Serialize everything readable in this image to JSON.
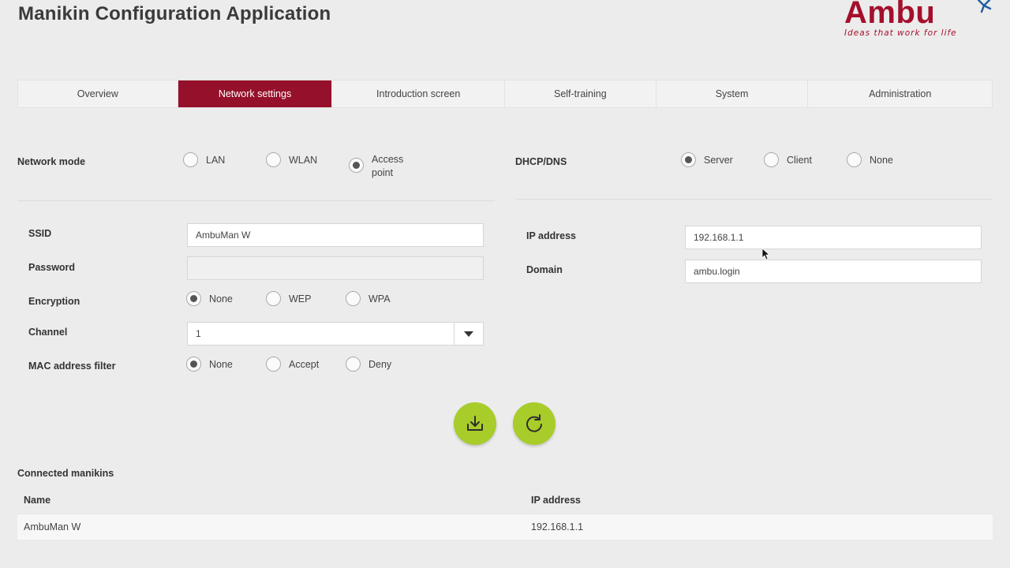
{
  "app": {
    "title": "Manikin Configuration Application"
  },
  "logo": {
    "word": "Ambu",
    "tagline": "Ideas that work for life",
    "color": "#a4102c"
  },
  "tabs": [
    {
      "label": "Overview",
      "active": false
    },
    {
      "label": "Network settings",
      "active": true
    },
    {
      "label": "Introduction screen",
      "active": false
    },
    {
      "label": "Self-training",
      "active": false
    },
    {
      "label": "System",
      "active": false
    },
    {
      "label": "Administration",
      "active": false
    }
  ],
  "network_mode": {
    "label": "Network mode",
    "options": [
      "LAN",
      "WLAN",
      "Access point"
    ],
    "selected": "Access point"
  },
  "dhcp_dns": {
    "label": "DHCP/DNS",
    "options": [
      "Server",
      "Client",
      "None"
    ],
    "selected": "Server"
  },
  "ssid": {
    "label": "SSID",
    "value": "AmbuMan W"
  },
  "password": {
    "label": "Password",
    "value": ""
  },
  "encryption": {
    "label": "Encryption",
    "options": [
      "None",
      "WEP",
      "WPA"
    ],
    "selected": "None"
  },
  "channel": {
    "label": "Channel",
    "value": "1"
  },
  "mac_filter": {
    "label": "MAC address filter",
    "options": [
      "None",
      "Accept",
      "Deny"
    ],
    "selected": "None"
  },
  "ip_address": {
    "label": "IP address",
    "value": "192.168.1.1"
  },
  "domain": {
    "label": "Domain",
    "value": "ambu.login"
  },
  "actions": {
    "save_icon": "download-icon",
    "reload_icon": "refresh-icon",
    "color": "#a8cc2a"
  },
  "connected": {
    "title": "Connected manikins",
    "columns": [
      "Name",
      "IP address"
    ],
    "rows": [
      {
        "name": "AmbuMan W",
        "ip": "192.168.1.1"
      }
    ]
  },
  "colors": {
    "accent": "#95102a",
    "background": "#ececec"
  }
}
